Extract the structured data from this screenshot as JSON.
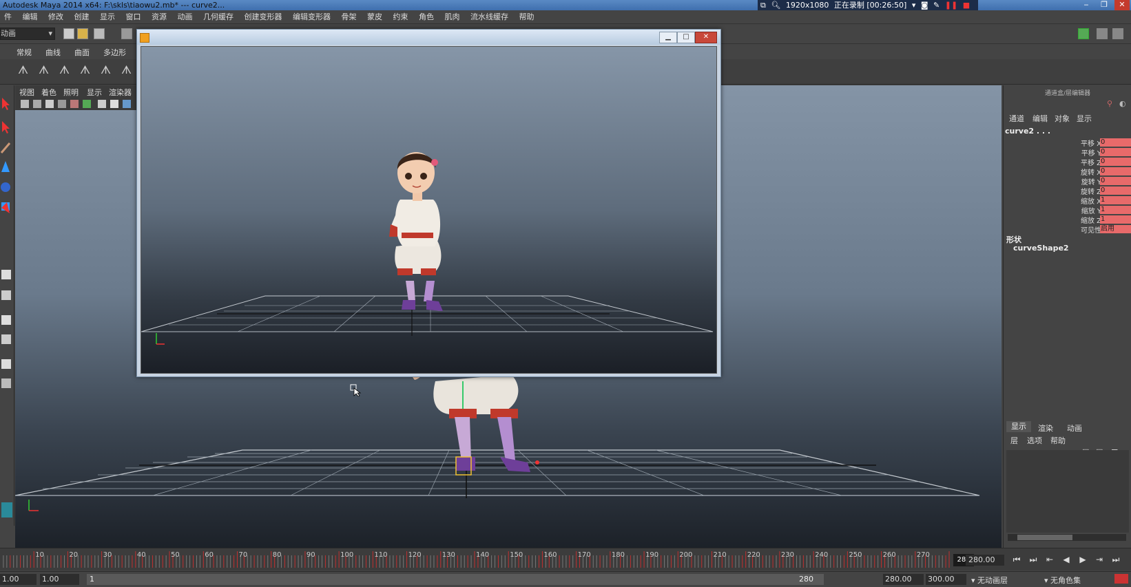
{
  "app": {
    "title": "Autodesk Maya 2014 x64: F:\\skls\\tiaowu2.mb*  ---  curve2...",
    "recorder": {
      "resolution": "1920x1080",
      "status": "正在录制 [00:26:50]"
    }
  },
  "menus": [
    "件",
    "编辑",
    "修改",
    "创建",
    "显示",
    "窗口",
    "资源",
    "动画",
    "几何缓存",
    "创建变形器",
    "编辑变形器",
    "骨架",
    "蒙皮",
    "约束",
    "角色",
    "肌肉",
    "流水线缓存",
    "帮助"
  ],
  "statusline": {
    "mode_combo": "动画"
  },
  "shelf": {
    "tabs": [
      "常规",
      "曲线",
      "曲面",
      "多边形"
    ]
  },
  "viewport": {
    "menus": [
      "视图",
      "着色",
      "照明",
      "显示",
      "渲染器"
    ],
    "bg_top": "#8494a6",
    "bg_bottom": "#1c2128"
  },
  "channel_box": {
    "header": "通道盒/层编辑器",
    "tabs": [
      "通道",
      "编辑",
      "对象",
      "显示"
    ],
    "object_name": "curve2 . . .",
    "channels": [
      {
        "label": "平移 X",
        "value": "0"
      },
      {
        "label": "平移 Y",
        "value": "0"
      },
      {
        "label": "平移 Z",
        "value": "0"
      },
      {
        "label": "旋转 X",
        "value": "0"
      },
      {
        "label": "旋转 Y",
        "value": "0"
      },
      {
        "label": "旋转 Z",
        "value": "0"
      },
      {
        "label": "缩放 X",
        "value": "1"
      },
      {
        "label": "缩放 Y",
        "value": "1"
      },
      {
        "label": "缩放 Z",
        "value": "1"
      },
      {
        "label": "可见性",
        "value": "启用"
      }
    ],
    "shapes_label": "形状",
    "shape_name": "curveShape2",
    "channel_color": "#e86a6a"
  },
  "layer_editor": {
    "tabs": [
      "显示",
      "渲染",
      "动画"
    ],
    "menus": [
      "层",
      "选项",
      "帮助"
    ]
  },
  "timeline": {
    "labels": [
      "10",
      "20",
      "30",
      "40",
      "50",
      "60",
      "70",
      "80",
      "90",
      "100",
      "110",
      "120",
      "130",
      "140",
      "150",
      "160",
      "170",
      "180",
      "190",
      "200",
      "210",
      "220",
      "230",
      "240",
      "250",
      "260",
      "270"
    ],
    "current_frame": "280",
    "current_time_field": "280.00"
  },
  "range_slider": {
    "start_time": "1.00",
    "playback_start": "1.00",
    "range_start": "1",
    "range_end": "280",
    "playback_end": "280.00",
    "end_time": "300.00",
    "anim_layer": "无动画层",
    "char_set": "无角色集"
  }
}
